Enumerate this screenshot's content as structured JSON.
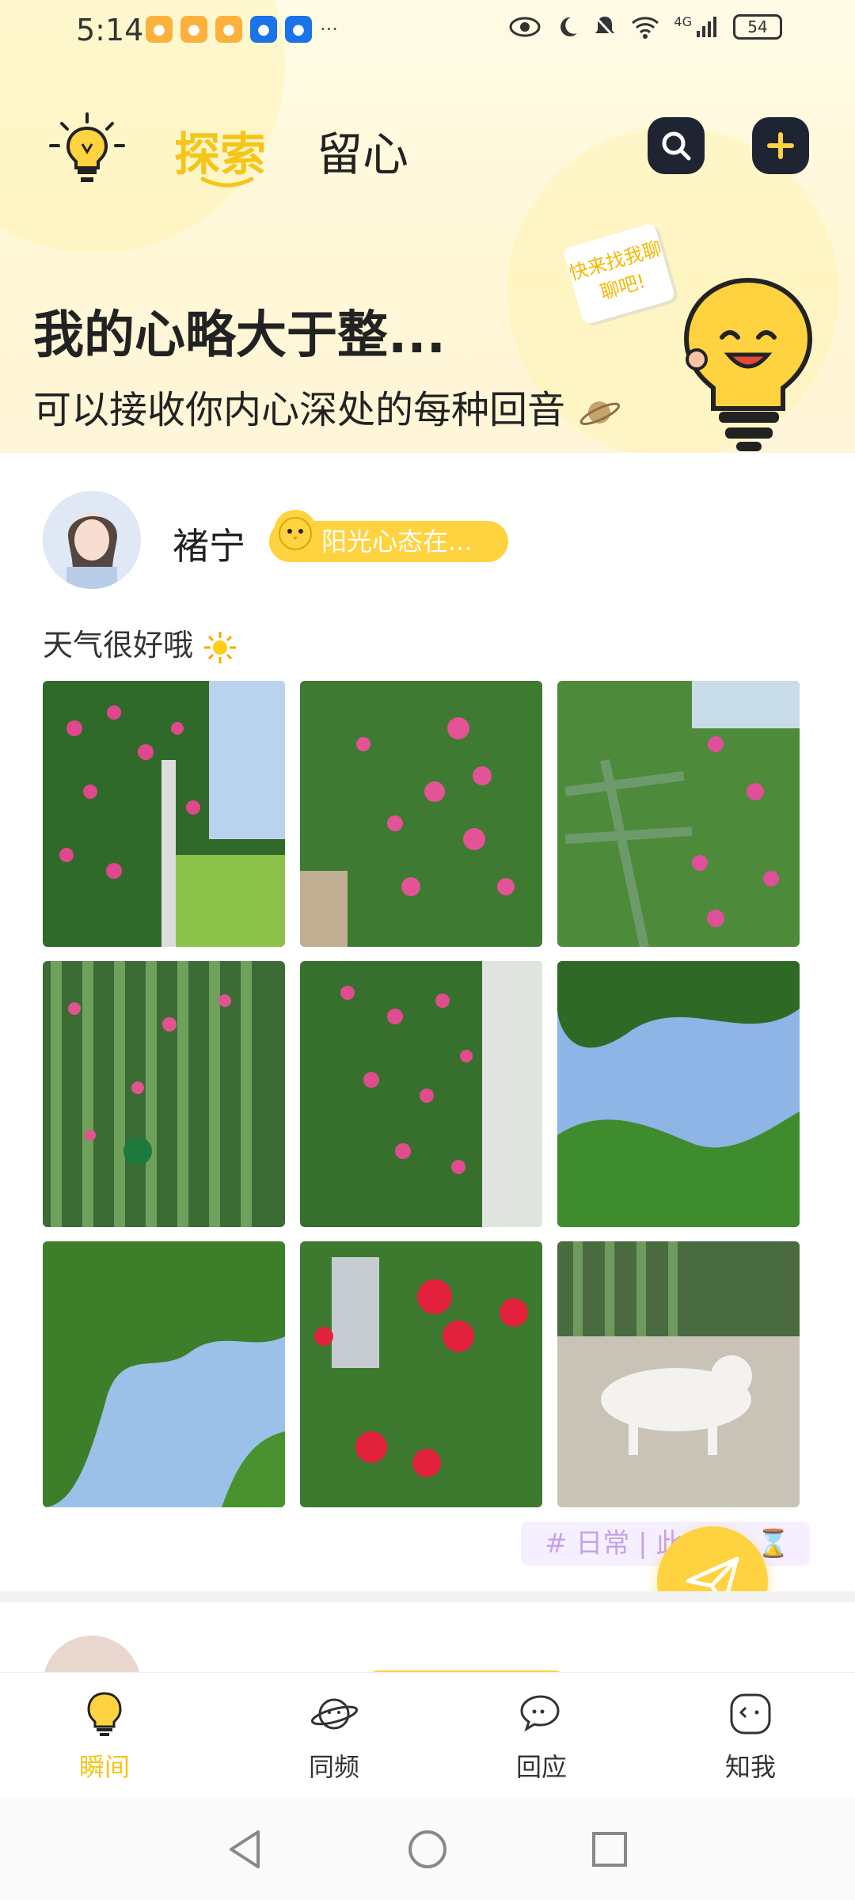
{
  "status_bar": {
    "time": "5:14",
    "notifications": [
      "weibo",
      "weibo",
      "weibo",
      "zhihu",
      "zhihu"
    ],
    "more": "···",
    "network": "4G",
    "battery": "54"
  },
  "header": {
    "tabs": [
      {
        "label": "探索",
        "active": true
      },
      {
        "label": "留心",
        "active": false
      }
    ],
    "hero_title": "我的心略大于整...",
    "hero_subtitle": "可以接收你内心深处的每种回音",
    "speech_bubble": "快来找我聊聊吧!"
  },
  "post": {
    "username": "褚宁",
    "mood": "阳光心态在...",
    "text": "天气很好哦",
    "photos": [
      {
        "desc": "rose-arch"
      },
      {
        "desc": "rose-bush"
      },
      {
        "desc": "rose-fence"
      },
      {
        "desc": "green-fence-roses"
      },
      {
        "desc": "rose-wall"
      },
      {
        "desc": "tree-sky"
      },
      {
        "desc": "tree-canopy"
      },
      {
        "desc": "red-flowers"
      },
      {
        "desc": "white-cat"
      }
    ],
    "topic_tag": "# 日常 | 此"
  },
  "bottom_nav": [
    {
      "label": "瞬间",
      "icon": "bulb-icon",
      "active": true
    },
    {
      "label": "同频",
      "icon": "planet-icon",
      "active": false
    },
    {
      "label": "回应",
      "icon": "chat-bubbles-icon",
      "active": false
    },
    {
      "label": "知我",
      "icon": "face-icon",
      "active": false
    }
  ],
  "colors": {
    "accent": "#f5c518",
    "dark_button": "#1f2433",
    "tag_text": "#c8a2e8"
  }
}
